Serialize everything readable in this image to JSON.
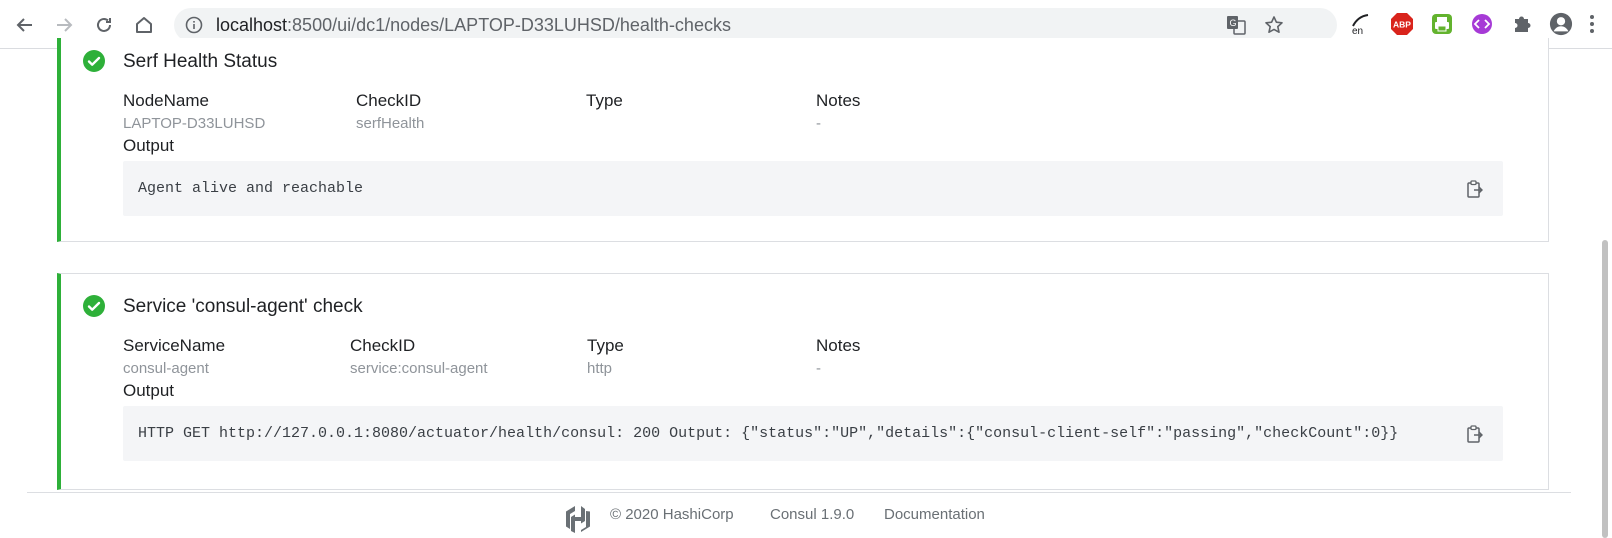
{
  "browser": {
    "url_host": "localhost",
    "url_rest": ":8500/ui/dc1/nodes/LAPTOP-D33LUHSD/health-checks",
    "abp_label": "ABP",
    "en_label": "en"
  },
  "checks": [
    {
      "title": "Serf Health Status",
      "status": "passing",
      "fields": [
        {
          "label": "NodeName",
          "value": "LAPTOP-D33LUHSD"
        },
        {
          "label": "CheckID",
          "value": "serfHealth"
        },
        {
          "label": "Type",
          "value": ""
        },
        {
          "label": "Notes",
          "value": "-"
        }
      ],
      "output_label": "Output",
      "output": "Agent alive and reachable"
    },
    {
      "title": "Service 'consul-agent' check",
      "status": "passing",
      "fields": [
        {
          "label": "ServiceName",
          "value": "consul-agent"
        },
        {
          "label": "CheckID",
          "value": "service:consul-agent"
        },
        {
          "label": "Type",
          "value": "http"
        },
        {
          "label": "Notes",
          "value": "-"
        }
      ],
      "output_label": "Output",
      "output": "HTTP GET http://127.0.0.1:8080/actuator/health/consul: 200  Output: {\"status\":\"UP\",\"details\":{\"consul-client-self\":\"passing\",\"checkCount\":0}}"
    }
  ],
  "footer": {
    "copyright": "© 2020 HashiCorp",
    "version": "Consul 1.9.0",
    "docs_link": "Documentation"
  },
  "colors": {
    "passing": "#2eb039",
    "output_bg": "#f4f5f7",
    "muted_text": "#8f949a"
  },
  "icons": [
    "back-arrow-icon",
    "forward-arrow-icon",
    "reload-icon",
    "home-icon",
    "info-icon",
    "translate-icon",
    "star-icon",
    "extensions-puzzle-icon",
    "profile-avatar-icon",
    "menu-dots-icon",
    "check-circle-icon",
    "copy-clipboard-icon",
    "hashicorp-logo-icon"
  ]
}
